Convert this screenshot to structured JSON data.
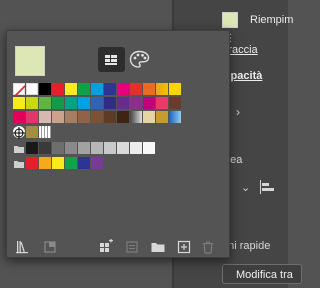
{
  "background_panel": {
    "fill_label": "Riempim",
    "stroke_label": "Traccia",
    "opacity_label": "Opacità",
    "line_label": "nea",
    "quick_actions_label": "oni rapide",
    "edit_button_label": "Modifica tra"
  },
  "swatches_popup": {
    "current_color": "#dde6b5",
    "view_mode": "grid",
    "rows": [
      [
        "#ffffff",
        "#ffffff",
        "#000000",
        "#e6202a",
        "#fbe91f",
        "#0ea247",
        "#00a0e3",
        "#2c3594",
        "#e5007e",
        "#e72f2a",
        "#ec6a1d",
        "#f6a91a",
        "#ffd500"
      ],
      [
        "#f7ed15",
        "#c7d80f",
        "#60b443",
        "#17994b",
        "#00a386",
        "#00a2e1",
        "#2e63b5",
        "#312d84",
        "#672d8d",
        "#8f2d8f",
        "#c4007c",
        "#ea3a6b",
        "#6b3b2c"
      ],
      [
        "#e4005a",
        "#e23569",
        "#d7b8b0",
        "#c9a38c",
        "#a97d62",
        "#916248",
        "#7c5137",
        "#5f3b24",
        "#3f2414",
        "#c8aa4e",
        "#e5d5a2",
        "#c69b32",
        "#2c6fb8"
      ],
      [
        "#ffffff",
        "#ffffff",
        "#ffffff"
      ],
      [
        "#ffffff",
        "#1a1a1a",
        "#3a3a3a",
        "#6e6e6e",
        "#8a8a8a",
        "#a2a2a2",
        "#b6b6b6",
        "#c9c9c9",
        "#dadada",
        "#ececec",
        "#f8f8f8"
      ],
      [
        "#ffffff",
        "#e6202a",
        "#f6a91a",
        "#fbe91f",
        "#12a34a",
        "#2c3594",
        "#7a3b96"
      ]
    ],
    "accent_color": "#2d2d2d"
  }
}
